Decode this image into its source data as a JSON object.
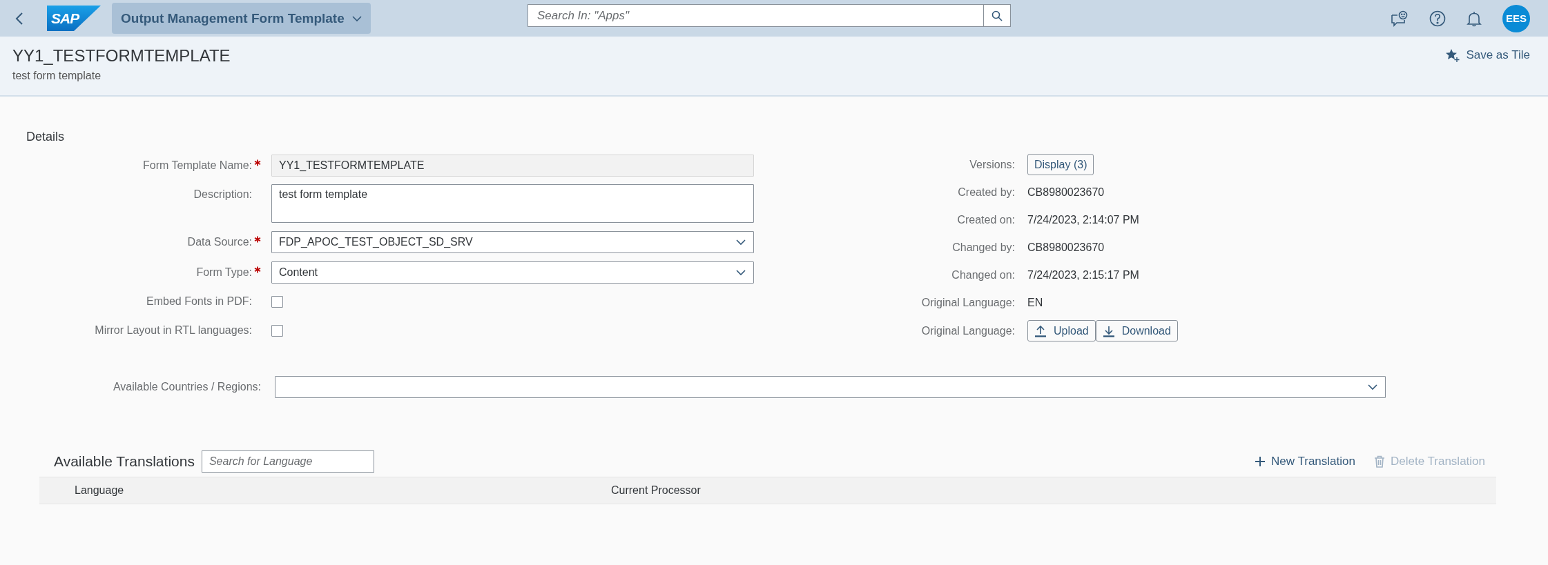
{
  "shell": {
    "logo": "SAP",
    "app_title": "Output Management Form Template",
    "search": {
      "placeholder": "Search In: \"Apps\""
    },
    "avatar": "EES"
  },
  "header": {
    "title": "YY1_TESTFORMTEMPLATE",
    "subtitle": "test form template",
    "save_as_tile": "Save as Tile"
  },
  "details": {
    "title": "Details",
    "left_fields": [
      {
        "kind": "input",
        "label": "Form Template Name:",
        "required": true,
        "value": "YY1_TESTFORMTEMPLATE",
        "disabled": true
      },
      {
        "kind": "textarea",
        "label": "Description:",
        "required": false,
        "value": "test form template",
        "disabled": false
      },
      {
        "kind": "select",
        "label": "Data Source:",
        "required": true,
        "value": "FDP_APOC_TEST_OBJECT_SD_SRV",
        "disabled": false
      },
      {
        "kind": "select",
        "label": "Form Type:",
        "required": true,
        "value": "Content",
        "disabled": false
      },
      {
        "kind": "checkbox",
        "label": "Embed Fonts in PDF:",
        "required": false,
        "checked": false
      },
      {
        "kind": "checkbox",
        "label": "Mirror Layout in RTL languages:",
        "required": false,
        "checked": false
      }
    ],
    "right_fields": [
      {
        "kind": "button",
        "label": "Versions:",
        "value": "Display (3)"
      },
      {
        "kind": "text",
        "label": "Created by:",
        "value": "CB8980023670"
      },
      {
        "kind": "text",
        "label": "Created on:",
        "value": "7/24/2023, 2:14:07 PM"
      },
      {
        "kind": "text",
        "label": "Changed by:",
        "value": "CB8980023670"
      },
      {
        "kind": "text",
        "label": "Changed on:",
        "value": "7/24/2023, 2:15:17 PM"
      },
      {
        "kind": "text",
        "label": "Original Language:",
        "value": "EN"
      },
      {
        "kind": "transfer",
        "label": "Original Language:",
        "upload": "Upload",
        "download": "Download"
      }
    ]
  },
  "countries": {
    "label": "Available Countries / Regions:"
  },
  "translations": {
    "title": "Available Translations",
    "search": {
      "placeholder": "Search for Language"
    },
    "actions": [
      {
        "kind": "add",
        "label": "New Translation",
        "disabled": false
      },
      {
        "kind": "delete",
        "label": "Delete Translation",
        "disabled": true
      }
    ],
    "columns": [
      "Language",
      "Current Processor"
    ]
  }
}
